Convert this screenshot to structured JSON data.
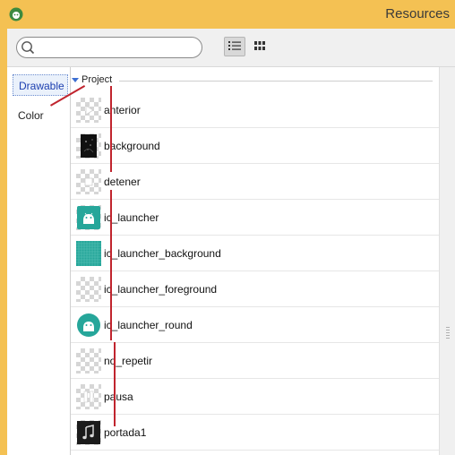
{
  "window": {
    "title": "Resources"
  },
  "toolbar": {
    "search": {
      "value": "",
      "placeholder": ""
    },
    "view_buttons": [
      {
        "icon": "list-view-icon",
        "selected": true
      },
      {
        "icon": "grid-view-icon",
        "selected": false
      }
    ]
  },
  "sidebar": {
    "items": [
      {
        "label": "Drawable",
        "selected": true
      },
      {
        "label": "Color",
        "selected": false
      }
    ]
  },
  "content": {
    "section": {
      "label": "Project",
      "expanded": true
    },
    "resources": [
      {
        "name": "anterior",
        "thumbnail": "play-icon-transparent"
      },
      {
        "name": "background",
        "thumbnail": "dark-image"
      },
      {
        "name": "detener",
        "thumbnail": "stop-icon-transparent"
      },
      {
        "name": "ic_launcher",
        "thumbnail": "android-launcher-icon"
      },
      {
        "name": "ic_launcher_background",
        "thumbnail": "teal-grid"
      },
      {
        "name": "ic_launcher_foreground",
        "thumbnail": "transparent"
      },
      {
        "name": "ic_launcher_round",
        "thumbnail": "android-round-icon"
      },
      {
        "name": "no_repetir",
        "thumbnail": "transparent"
      },
      {
        "name": "pausa",
        "thumbnail": "pause-icon-transparent"
      },
      {
        "name": "portada1",
        "thumbnail": "music-note-dark"
      }
    ]
  },
  "colors": {
    "titlebar": "#f4c153",
    "accent_teal": "#26a69a",
    "annotation_red": "#c0242e",
    "selection_blue": "#1c3fb0"
  }
}
